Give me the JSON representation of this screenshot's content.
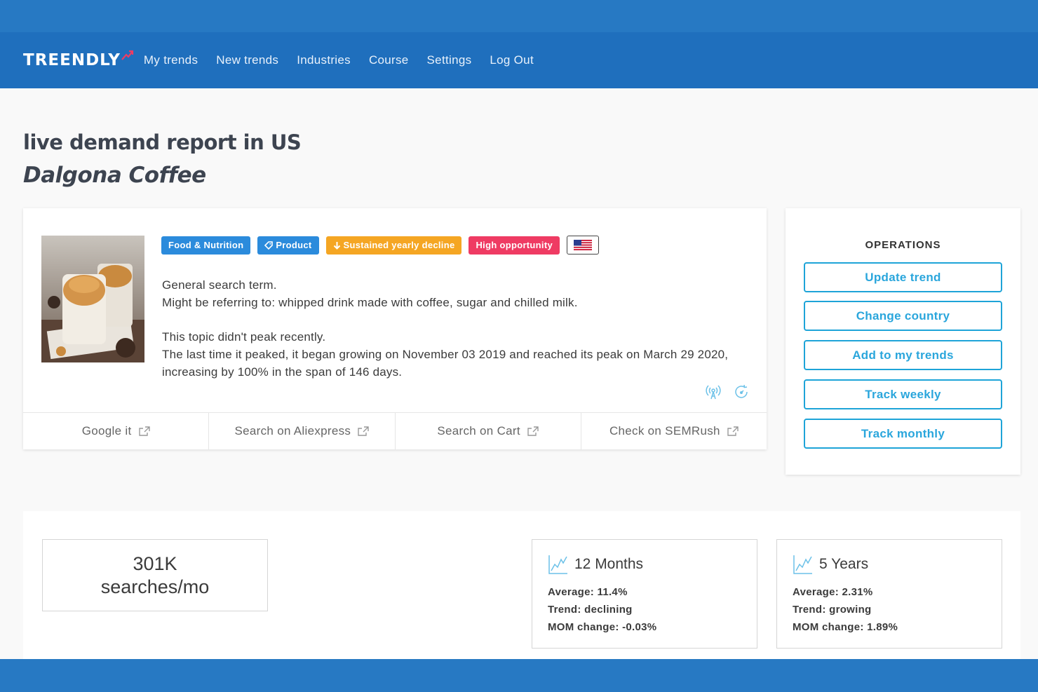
{
  "brand": {
    "logo_text": "TREENDLY"
  },
  "nav": {
    "items": [
      {
        "label": "My trends"
      },
      {
        "label": "New trends"
      },
      {
        "label": "Industries"
      },
      {
        "label": "Course"
      },
      {
        "label": "Settings"
      },
      {
        "label": "Log Out"
      }
    ]
  },
  "header": {
    "heading": "live demand report in US",
    "title": "Dalgona Coffee"
  },
  "trend": {
    "badges": [
      {
        "label": "Food & Nutrition",
        "color": "#2b8bdc"
      },
      {
        "label": "Product",
        "icon": "tag-icon",
        "color": "#2b8bdc"
      },
      {
        "label": "Sustained yearly decline",
        "icon": "arrow-down-icon",
        "color": "#f5a623"
      },
      {
        "label": "High opportunity",
        "color": "#ef3b63"
      }
    ],
    "country_flag": "us-flag-icon",
    "description": {
      "line1": "General search term.",
      "line2": "Might be referring to: whipped drink made with coffee, sugar and chilled milk.",
      "line3": "This topic didn't peak recently.",
      "line4": "The last time it peaked, it began growing on November 03 2019 and reached its peak on March 29 2020, increasing by 100% in the span of 146 days."
    },
    "action_icons": [
      "broadcast-icon",
      "refresh-icon"
    ],
    "links": [
      {
        "label": "Google it"
      },
      {
        "label": "Search on Aliexpress"
      },
      {
        "label": "Search on Cart"
      },
      {
        "label": "Check on SEMRush"
      }
    ]
  },
  "operations": {
    "title": "OPERATIONS",
    "buttons": [
      {
        "label": "Update trend"
      },
      {
        "label": "Change country"
      },
      {
        "label": "Add to my trends"
      },
      {
        "label": "Track weekly"
      },
      {
        "label": "Track monthly"
      }
    ]
  },
  "stats": {
    "searches_value": "301K",
    "searches_unit": "searches/mo",
    "twelve_months": {
      "title": "12 Months",
      "average": "Average: 11.4%",
      "trend": "Trend: declining",
      "mom": "MOM change: -0.03%"
    },
    "five_years": {
      "title": "5 Years",
      "average": "Average: 2.31%",
      "trend": "Trend: growing",
      "mom": "MOM change: 1.89%"
    }
  },
  "colors": {
    "nav_bg": "#1f6fbd",
    "band_bg": "#2779c3",
    "accent": "#1ea4d8",
    "badge_blue": "#2b8bdc",
    "badge_orange": "#f5a623",
    "badge_red": "#ef3b63"
  }
}
